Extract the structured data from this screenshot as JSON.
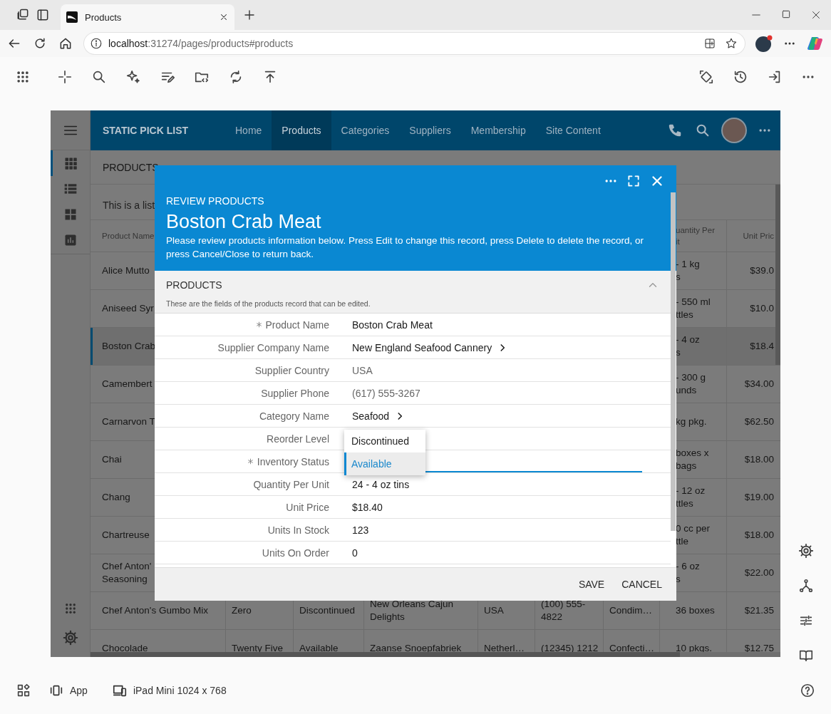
{
  "browser": {
    "tab_title": "Products",
    "url_host": "localhost",
    "url_path": ":31274/pages/products#products"
  },
  "app": {
    "brand": "STATIC PICK LIST",
    "nav": [
      {
        "label": "Home",
        "selected": false
      },
      {
        "label": "Products",
        "selected": true
      },
      {
        "label": "Categories",
        "selected": false
      },
      {
        "label": "Suppliers",
        "selected": false
      },
      {
        "label": "Membership",
        "selected": false
      },
      {
        "label": "Site Content",
        "selected": false
      }
    ],
    "rail": [
      {
        "selected": true
      },
      {
        "selected": false
      },
      {
        "selected": false
      },
      {
        "selected": false
      }
    ],
    "toolbar_title": "PRODUCTS",
    "description": "This is a list"
  },
  "table": {
    "columns": [
      {
        "label": "Product Name"
      },
      {},
      {},
      {},
      {},
      {},
      {},
      {
        "label": "uantity Per\nit"
      },
      {
        "label": "Unit Pric"
      }
    ],
    "rows": [
      {
        "selected": false,
        "cells": [
          "Alice Mutto",
          null,
          null,
          null,
          null,
          null,
          null,
          "- 1 kg\ns",
          "$39.0"
        ]
      },
      {
        "selected": false,
        "cells": [
          "Aniseed Syr",
          null,
          null,
          null,
          null,
          null,
          null,
          "- 550 ml\nttles",
          "$10.0"
        ]
      },
      {
        "selected": true,
        "cells": [
          "Boston Crab",
          null,
          null,
          null,
          null,
          null,
          null,
          "- 4 oz\ns",
          "$18.4"
        ]
      },
      {
        "selected": false,
        "cells": [
          "Camembert",
          null,
          null,
          null,
          null,
          null,
          null,
          "- 300 g\nunds",
          "$34.00"
        ]
      },
      {
        "selected": false,
        "cells": [
          "Carnarvon T",
          null,
          null,
          null,
          null,
          null,
          null,
          "kg pkg.",
          "$62.50"
        ]
      },
      {
        "selected": false,
        "cells": [
          "Chai",
          null,
          null,
          null,
          null,
          null,
          null,
          "boxes x\nbags",
          "$18.00"
        ]
      },
      {
        "selected": false,
        "cells": [
          "Chang",
          null,
          null,
          null,
          null,
          null,
          null,
          "- 12 oz\nttles",
          "$19.00"
        ]
      },
      {
        "selected": false,
        "cells": [
          "Chartreuse",
          null,
          null,
          null,
          null,
          null,
          null,
          "0 cc per\nttle",
          "$18.00"
        ]
      },
      {
        "selected": false,
        "cells": [
          "Chef Anton'\nSeasoning",
          null,
          null,
          null,
          null,
          null,
          null,
          "- 6 oz\ns",
          "$22.00"
        ]
      },
      {
        "selected": false,
        "cells": [
          "Chef Anton's Gumbo Mix",
          "Zero",
          "Discontinued",
          "New Orleans Cajun Delights",
          "USA",
          "(100) 555-4822",
          "Condim…",
          "36 boxes",
          "$21.35"
        ]
      },
      {
        "selected": false,
        "cells": [
          "Chocolade",
          "Twenty Five",
          "Available",
          "Zaanse Snoepfabriek",
          "Netherl…",
          "(12345) 1212",
          "Confecti…",
          "10 pkgs.",
          "$12.75"
        ]
      }
    ]
  },
  "dialog": {
    "eyebrow": "REVIEW PRODUCTS",
    "title": "Boston Crab Meat",
    "description": "Please review products information below. Press Edit to change this record, press Delete to delete the record, or press Cancel/Close to return back.",
    "category": {
      "title": "PRODUCTS",
      "description": "These are the fields of the products record that can be edited.",
      "expanded": true
    },
    "fields": [
      {
        "label": "Product Name",
        "required": true,
        "kind": "text",
        "value": "Boston Crab Meat"
      },
      {
        "label": "Supplier Company Name",
        "required": false,
        "kind": "lookup",
        "value": "New England Seafood Cannery"
      },
      {
        "label": "Supplier Country",
        "required": false,
        "kind": "readonly",
        "value": "USA"
      },
      {
        "label": "Supplier Phone",
        "required": false,
        "kind": "readonly",
        "value": "(617) 555-3267"
      },
      {
        "label": "Category Name",
        "required": false,
        "kind": "lookup",
        "value": "Seafood"
      },
      {
        "label": "Reorder Level",
        "required": false,
        "kind": "text"
      },
      {
        "label": "Inventory Status",
        "required": true,
        "kind": "dropdown"
      },
      {
        "label": "Quantity Per Unit",
        "required": false,
        "kind": "text",
        "value": "24 - 4 oz tins"
      },
      {
        "label": "Unit Price",
        "required": false,
        "kind": "text",
        "value": "$18.40"
      },
      {
        "label": "Units In Stock",
        "required": false,
        "kind": "text",
        "value": "123"
      },
      {
        "label": "Units On Order",
        "required": false,
        "kind": "text",
        "value": "0"
      }
    ],
    "dropdown_options": [
      {
        "label": "Discontinued",
        "selected": false
      },
      {
        "label": "Available",
        "selected": true
      }
    ],
    "actions": [
      "SAVE",
      "CANCEL"
    ]
  },
  "bottom_bar": {
    "app_label": "App",
    "device_label": "iPad Mini 1024 x 768"
  }
}
